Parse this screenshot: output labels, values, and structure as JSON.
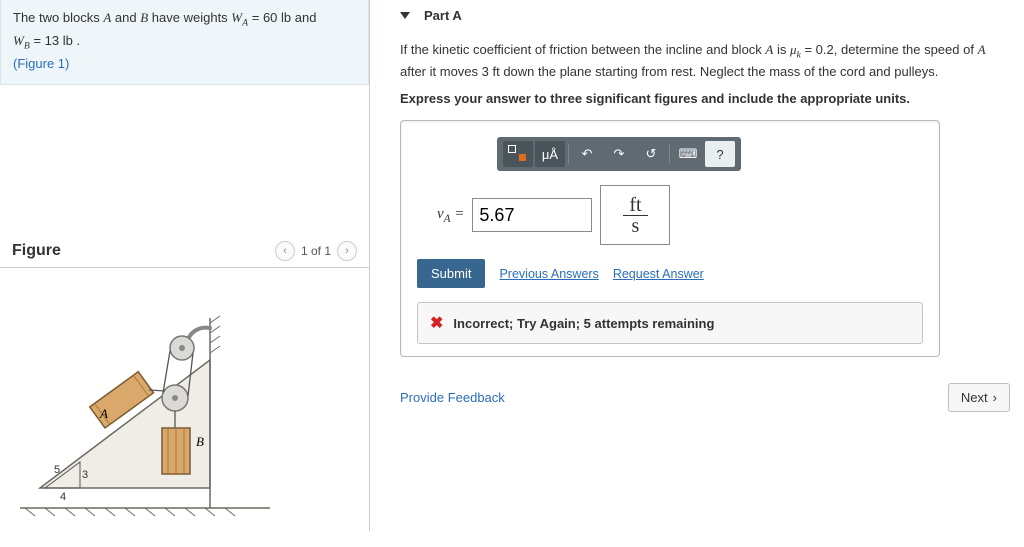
{
  "problem": {
    "text_pre": "The two blocks ",
    "varA": "A",
    "text_and": " and ",
    "varB": "B",
    "text_have": " have weights ",
    "WA_sym": "W",
    "WA_sub": "A",
    "WA_eq": " = 60 lb and",
    "WB_sym": "W",
    "WB_sub": "B",
    "WB_eq": " = 13 lb .",
    "figlink": "(Figure 1)"
  },
  "figure": {
    "title": "Figure",
    "pager": "1 of 1",
    "labelA": "A",
    "labelB": "B",
    "tri5": "5",
    "tri3": "3",
    "tri4": "4"
  },
  "part": {
    "title": "Part A",
    "instr_p1": "If the kinetic coefficient of friction between the incline and block ",
    "instr_A": "A",
    "instr_p2": " is ",
    "instr_mu": "μ",
    "instr_mu_sub": "k",
    "instr_p3": " = 0.2, determine the speed of ",
    "instr_A2": "A",
    "instr_p4": " after it moves 3 ft down the plane starting from rest. Neglect the mass of the cord and pulleys.",
    "instr_bold": "Express your answer to three significant figures and include the appropriate units.",
    "toolbar": {
      "mua": "μÅ",
      "help": "?"
    },
    "answer": {
      "var": "v",
      "sub": "A",
      "eq": " = ",
      "value": "5.67",
      "unit_num": "ft",
      "unit_den": "s"
    },
    "submit": "Submit",
    "previous": "Previous Answers",
    "request": "Request Answer",
    "feedback": "Incorrect; Try Again; 5 attempts remaining"
  },
  "footer": {
    "provide": "Provide Feedback",
    "next": "Next"
  }
}
